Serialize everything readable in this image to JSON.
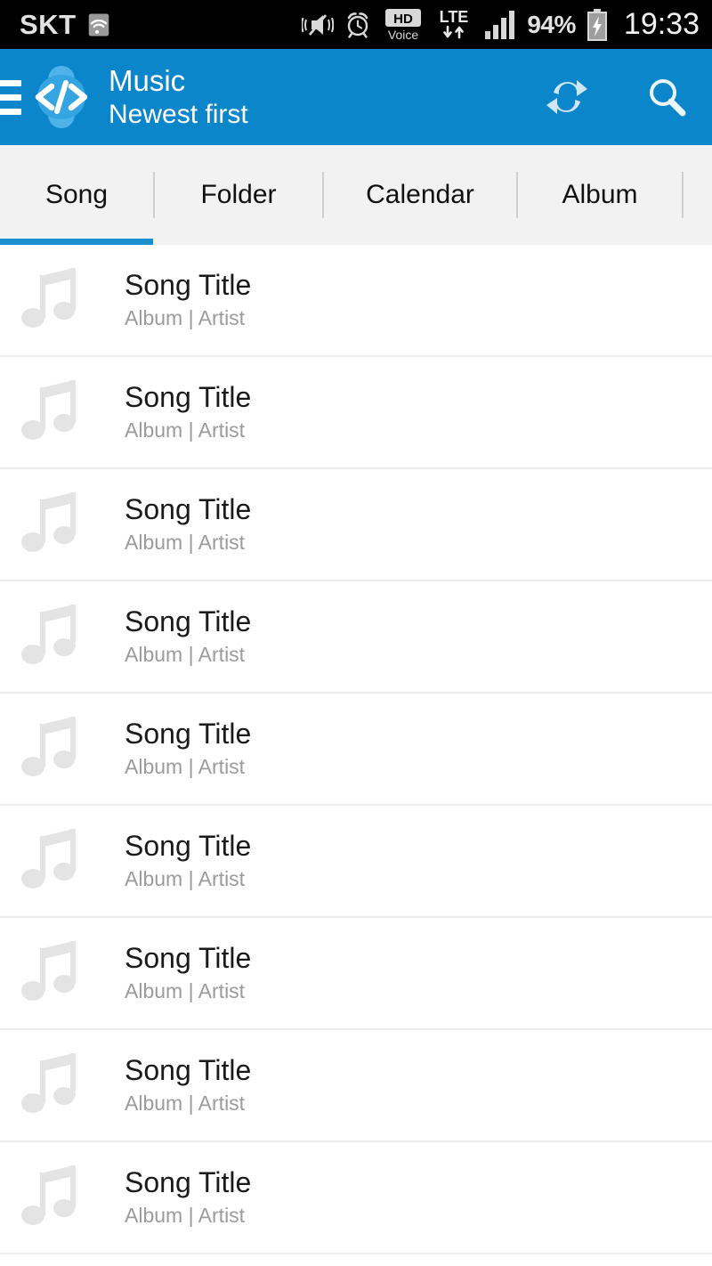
{
  "status_bar": {
    "carrier": "SKT",
    "icons": [
      "wifi-icon",
      "vibrate-mute-icon",
      "alarm-clock-icon",
      "hd-voice-icon",
      "lte-data-icon",
      "signal-bars-icon"
    ],
    "battery_percent": "94%",
    "battery_state": "charging",
    "time": "19:33",
    "background": "#000000",
    "foreground": "#d8d8d8"
  },
  "app_bar": {
    "menu_icon": "hamburger-menu-icon",
    "logo_icon": "code-brackets-logo",
    "logo_glyph": "</>",
    "title": "Music",
    "subtitle": "Newest first",
    "sort_indicator": "sort-triangle-icon",
    "actions": [
      {
        "name": "refresh-button",
        "icon": "refresh-icon"
      },
      {
        "name": "search-button",
        "icon": "search-icon"
      }
    ],
    "background": "#0b86cb",
    "text_color": "#ffffff"
  },
  "tabs": {
    "active_index": 0,
    "items": [
      {
        "label": "Song"
      },
      {
        "label": "Folder"
      },
      {
        "label": "Calendar"
      },
      {
        "label": "Album"
      }
    ],
    "active_color": "#1a8fcc",
    "background": "#f2f2f2"
  },
  "song_list": {
    "rows": [
      {
        "title": "Song Title",
        "subtitle": "Album | Artist",
        "icon": "music-note-icon"
      },
      {
        "title": "Song Title",
        "subtitle": "Album | Artist",
        "icon": "music-note-icon"
      },
      {
        "title": "Song Title",
        "subtitle": "Album | Artist",
        "icon": "music-note-icon"
      },
      {
        "title": "Song Title",
        "subtitle": "Album | Artist",
        "icon": "music-note-icon"
      },
      {
        "title": "Song Title",
        "subtitle": "Album | Artist",
        "icon": "music-note-icon"
      },
      {
        "title": "Song Title",
        "subtitle": "Album | Artist",
        "icon": "music-note-icon"
      },
      {
        "title": "Song Title",
        "subtitle": "Album | Artist",
        "icon": "music-note-icon"
      },
      {
        "title": "Song Title",
        "subtitle": "Album | Artist",
        "icon": "music-note-icon"
      },
      {
        "title": "Song Title",
        "subtitle": "Album | Artist",
        "icon": "music-note-icon"
      }
    ]
  }
}
